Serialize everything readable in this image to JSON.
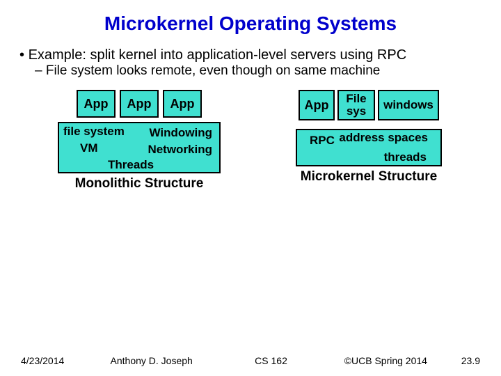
{
  "title": "Microkernel Operating Systems",
  "bullet_main": "Example: split kernel into application-level servers using RPC",
  "bullet_sub": "File system looks remote, even though on same machine",
  "left": {
    "apps": [
      "App",
      "App",
      "App"
    ],
    "kernel": {
      "fs": "file system",
      "win": "Windowing",
      "vm": "VM",
      "net": "Networking",
      "thr": "Threads"
    },
    "caption": "Monolithic Structure"
  },
  "right": {
    "servers": {
      "app": "App",
      "fs": "File sys",
      "win": "windows"
    },
    "kernel": {
      "rpc": "RPC",
      "as": "address spaces",
      "thr": "threads"
    },
    "caption": "Microkernel Structure"
  },
  "footer": {
    "date": "4/23/2014",
    "author": "Anthony D. Joseph",
    "course": "CS 162",
    "copyright": "©UCB Spring 2014",
    "page": "23.9"
  }
}
